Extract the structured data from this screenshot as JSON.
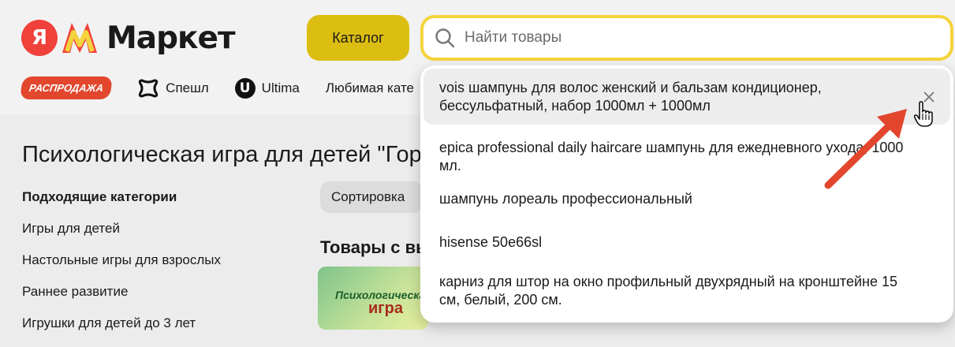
{
  "header": {
    "logo_ya": "Я",
    "logo_text": "Маркет",
    "catalog_label": "Каталог",
    "search_placeholder": "Найти товары"
  },
  "nav": {
    "sale_label": "РАСПРОДАЖА",
    "items": [
      {
        "label": "Спешл",
        "icon": "special-icon"
      },
      {
        "label": "Ultima",
        "icon": "ultima-icon"
      },
      {
        "label": "Любимая кате",
        "icon": null
      }
    ]
  },
  "page": {
    "title": "Психологическая игра для детей \"Гор",
    "sort_label": "Сортировка",
    "products_title": "Товары с вы",
    "product_image_text": [
      "Психологическая",
      "игра"
    ]
  },
  "sidebar": {
    "heading": "Подходящие категории",
    "categories": [
      "Игры для детей",
      "Настольные игры для взрослых",
      "Раннее развитие",
      "Игрушки для детей до 3 лет"
    ]
  },
  "suggestions": [
    {
      "text": "vois шампунь для волос женский и бальзам кондиционер, бессульфатный, набор 1000мл + 1000мл",
      "hovered": true
    },
    {
      "text": "epica professional daily haircare шампунь для ежедневного ухода, 1000 мл.",
      "hovered": false
    },
    {
      "text": "шампунь лореаль профессиональный",
      "hovered": false
    },
    {
      "text": "hisense 50e66sl",
      "hovered": false
    },
    {
      "text": "карниз для штор на окно профильный двухрядный на кронштейне 15 см, белый, 200 см.",
      "hovered": false
    }
  ],
  "colors": {
    "accent_yellow": "#f5d33c",
    "catalog_yellow": "#dcbe12",
    "sale_red": "#e2472e",
    "annotation_arrow": "#e2472e"
  }
}
